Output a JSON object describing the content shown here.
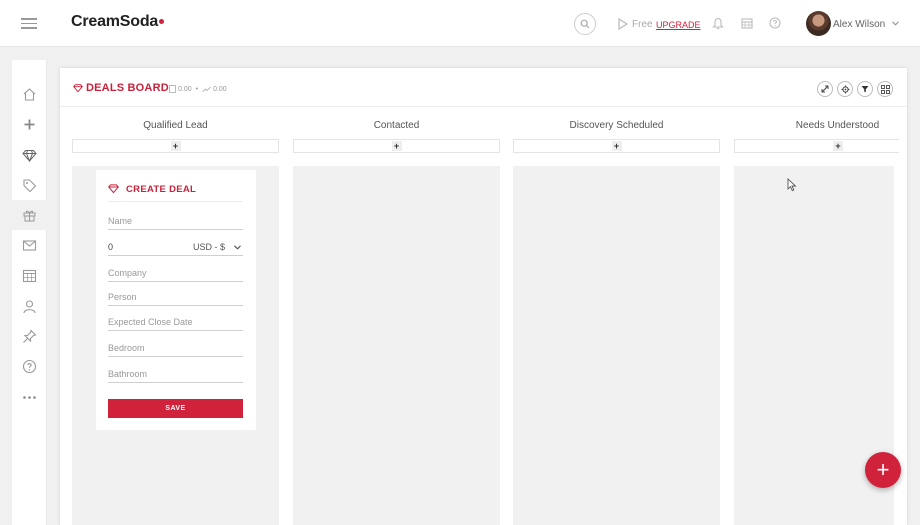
{
  "header": {
    "logo": "CreamSoda",
    "free_label": "Free",
    "upgrade_label": "UPGRADE",
    "user_name": "Alex Wilson"
  },
  "sidebar": {
    "items": [
      "home-icon",
      "plus-icon",
      "deals-icon",
      "tag-icon",
      "gift-icon",
      "mail-icon",
      "calendar-icon",
      "contacts-icon",
      "pin-icon",
      "help-icon",
      "more-icon"
    ],
    "active": "deals-icon"
  },
  "board": {
    "title": "DEALS BOARD",
    "meta_value": "0.00",
    "meta_trend": "0.00",
    "columns": [
      {
        "label": "Qualified Lead"
      },
      {
        "label": "Contacted"
      },
      {
        "label": "Discovery Scheduled"
      },
      {
        "label": "Needs Understood"
      }
    ],
    "add_symbol": "+"
  },
  "create_deal": {
    "title": "CREATE DEAL",
    "name_placeholder": "Name",
    "amount_value": "0",
    "currency": "USD - $",
    "company_placeholder": "Company",
    "person_placeholder": "Person",
    "close_date_placeholder": "Expected Close Date",
    "bedroom_placeholder": "Bedroom",
    "bathroom_placeholder": "Bathroom",
    "save_label": "SAVE"
  },
  "fab_symbol": "+",
  "colors": {
    "accent": "#d0223b"
  }
}
